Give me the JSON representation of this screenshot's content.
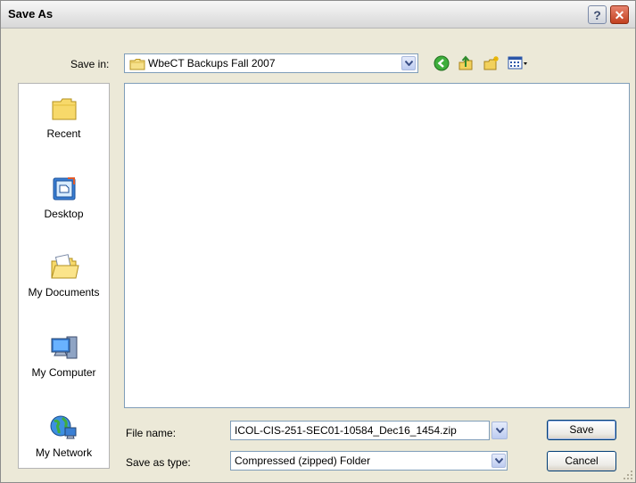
{
  "window": {
    "title": "Save As",
    "help_glyph": "?",
    "close_glyph": "✕"
  },
  "toolbar": {
    "save_in_label": "Save in:",
    "save_in_value": "WbeCT Backups Fall 2007",
    "icons": [
      "back-icon",
      "up-folder-icon",
      "new-folder-icon",
      "views-menu-icon"
    ]
  },
  "places": [
    {
      "label": "Recent",
      "icon": "recent-folder-icon"
    },
    {
      "label": "Desktop",
      "icon": "desktop-icon"
    },
    {
      "label": "My Documents",
      "icon": "my-documents-icon"
    },
    {
      "label": "My Computer",
      "icon": "my-computer-icon"
    },
    {
      "label": "My Network",
      "icon": "my-network-icon"
    }
  ],
  "form": {
    "file_name_label": "File name:",
    "file_name_value": "ICOL-CIS-251-SEC01-10584_Dec16_1454.zip",
    "save_as_type_label": "Save as type:",
    "save_as_type_value": "Compressed (zipped) Folder"
  },
  "buttons": {
    "save": "Save",
    "cancel": "Cancel"
  },
  "colors": {
    "dialog_bg": "#ece9d8",
    "border_blue": "#7f9db9",
    "close_red": "#c2401f"
  }
}
